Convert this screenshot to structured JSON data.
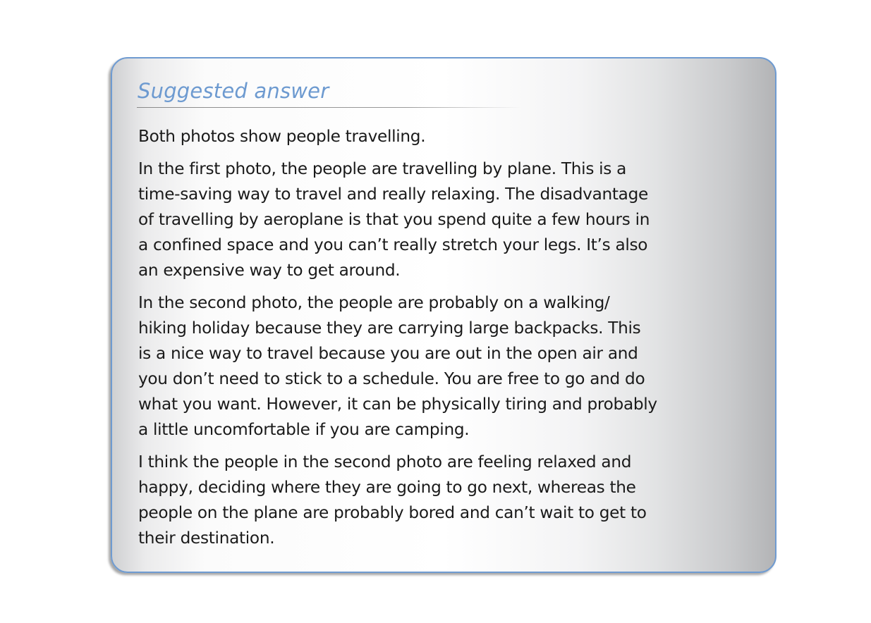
{
  "card": {
    "heading": "Suggested answer",
    "paragraphs": [
      "Both photos show people travelling.",
      "In the first photo, the people are travelling by plane. This is a\ntime-saving way to travel and really relaxing. The disadvantage\nof travelling by aeroplane is that you spend quite a few hours in\na confined space and you can’t really stretch your legs. It’s also\nan expensive way to get around.",
      "In the second photo, the people are probably on a walking/\nhiking holiday because they are carrying large backpacks. This\nis a nice way to travel because you are out in the open air and\nyou don’t need to stick to a schedule. You are free to go and do\nwhat you want. However, it can be physically tiring and probably\na little uncomfortable if you are camping.",
      "I think the people in the second photo are feeling relaxed and\nhappy, deciding where they are going to go next, whereas the\npeople on the plane are probably bored and can’t wait to get to\ntheir destination."
    ]
  },
  "colors": {
    "heading": "#6d9ad0",
    "border": "#6f9bd1",
    "text": "#1a1a1a"
  }
}
